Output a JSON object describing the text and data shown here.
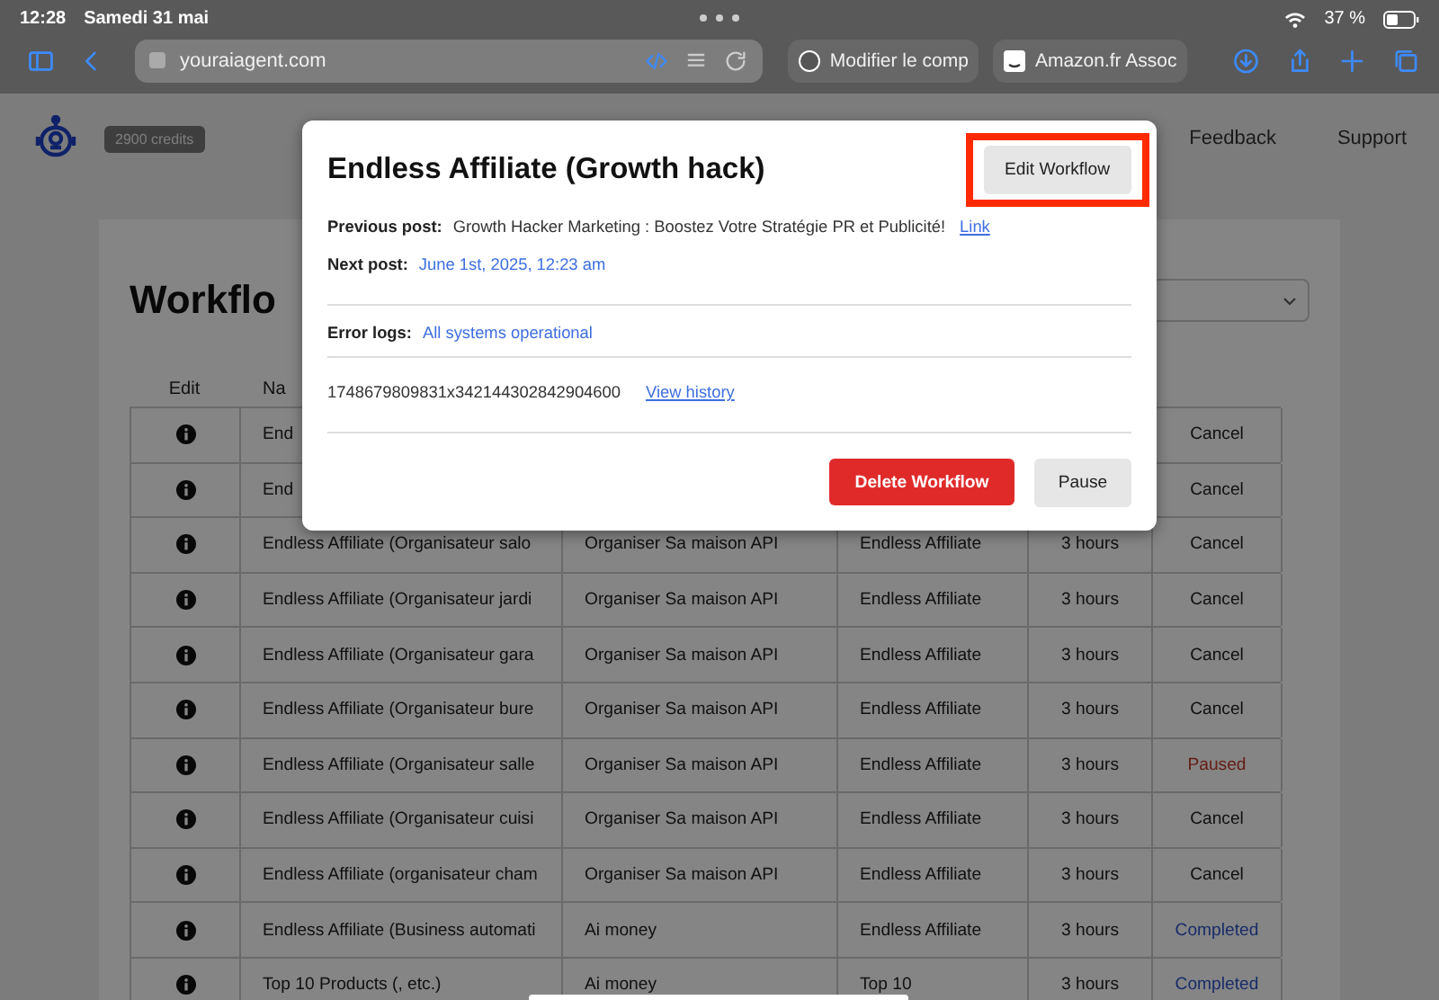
{
  "status_bar": {
    "time": "12:28",
    "date": "Samedi 31 mai",
    "battery": "37 %"
  },
  "browser": {
    "url": "youraiagent.com",
    "tabs": [
      {
        "label": "Modifier le comp"
      },
      {
        "label": "Amazon.fr Assoc"
      }
    ]
  },
  "header": {
    "credits": "2900 credits",
    "nav": [
      "Feedback",
      "Support"
    ]
  },
  "page": {
    "title": "Workflo",
    "columns": [
      "Edit",
      "Na"
    ]
  },
  "table": {
    "rows": [
      {
        "name": "End",
        "status": "Cancel",
        "kind": "cancel"
      },
      {
        "name": "End",
        "status": "Cancel",
        "kind": "cancel"
      },
      {
        "name": "Endless Affiliate (Organisateur salo",
        "project": "Organiser Sa maison API",
        "template": "Endless Affiliate",
        "frequency": "3 hours",
        "status": "Cancel",
        "kind": "cancel"
      },
      {
        "name": "Endless Affiliate (Organisateur jardi",
        "project": "Organiser Sa maison API",
        "template": "Endless Affiliate",
        "frequency": "3 hours",
        "status": "Cancel",
        "kind": "cancel"
      },
      {
        "name": "Endless Affiliate (Organisateur gara",
        "project": "Organiser Sa maison API",
        "template": "Endless Affiliate",
        "frequency": "3 hours",
        "status": "Cancel",
        "kind": "cancel"
      },
      {
        "name": "Endless Affiliate (Organisateur bure",
        "project": "Organiser Sa maison API",
        "template": "Endless Affiliate",
        "frequency": "3 hours",
        "status": "Cancel",
        "kind": "cancel"
      },
      {
        "name": "Endless Affiliate (Organisateur salle",
        "project": "Organiser Sa maison API",
        "template": "Endless Affiliate",
        "frequency": "3 hours",
        "status": "Paused",
        "kind": "paused"
      },
      {
        "name": "Endless Affiliate (Organisateur cuisi",
        "project": "Organiser Sa maison API",
        "template": "Endless Affiliate",
        "frequency": "3 hours",
        "status": "Cancel",
        "kind": "cancel"
      },
      {
        "name": "Endless Affiliate (organisateur cham",
        "project": "Organiser Sa maison API",
        "template": "Endless Affiliate",
        "frequency": "3 hours",
        "status": "Cancel",
        "kind": "cancel"
      },
      {
        "name": "Endless Affiliate (Business automati",
        "project": "Ai money",
        "template": "Endless Affiliate",
        "frequency": "3 hours",
        "status": "Completed",
        "kind": "completed"
      },
      {
        "name": "Top 10 Products (, etc.)",
        "project": "Ai money",
        "template": "Top 10",
        "frequency": "3 hours",
        "status": "Completed",
        "kind": "completed"
      }
    ]
  },
  "modal": {
    "title": "Endless Affiliate (Growth hack)",
    "edit_button": "Edit Workflow",
    "highlighted": true,
    "previous_label": "Previous post:",
    "previous_value": "Growth Hacker Marketing : Boostez Votre Stratégie PR et Publicité!",
    "previous_link": "Link",
    "next_label": "Next post:",
    "next_value": "June 1st, 2025, 12:23 am",
    "error_label": "Error logs:",
    "error_value": "All systems operational",
    "id": "1748679809831x342144302842904600",
    "history_link": "View history",
    "delete_button": "Delete Workflow",
    "pause_button": "Pause"
  }
}
